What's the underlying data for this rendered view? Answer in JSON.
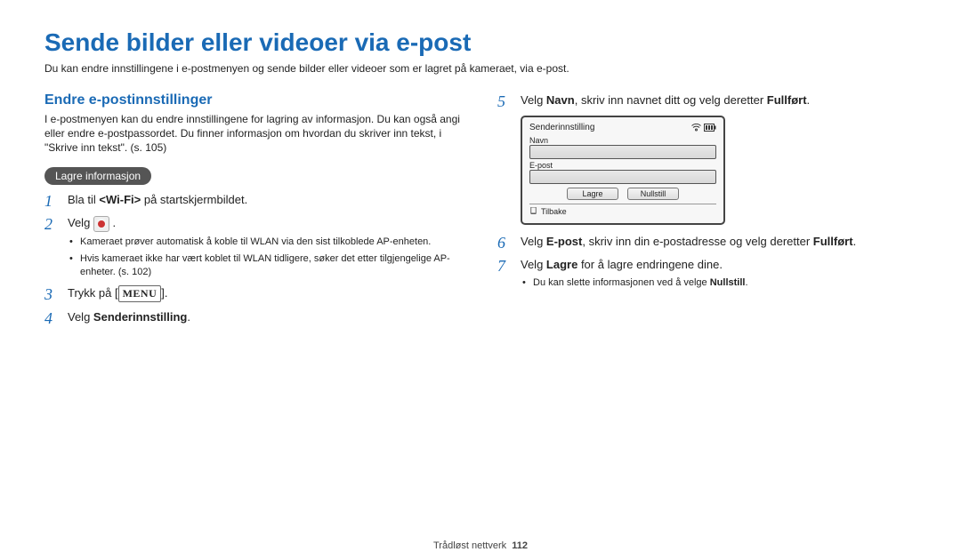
{
  "title": "Sende bilder eller videoer via e-post",
  "description": "Du kan endre innstillingene i e-postmenyen og sende bilder eller videoer som er lagret på kameraet, via e-post.",
  "section": {
    "heading": "Endre e-postinnstillinger",
    "body": "I e-postmenyen kan du endre innstillingene for lagring av informasjon. Du kan også angi eller endre e-postpassordet. Du finner informasjon om hvordan du skriver inn tekst, i \"Skrive inn tekst\". (s. 105)"
  },
  "pill_label": "Lagre informasjon",
  "left_steps": {
    "s1": {
      "pre": "Bla til ",
      "wifi": "<Wi-Fi>",
      "post": " på startskjermbildet."
    },
    "s2": {
      "pre": "Velg ",
      "post": " ."
    },
    "s2_subs": [
      "Kameraet prøver automatisk å koble til WLAN via den sist tilkoblede AP-enheten.",
      "Hvis kameraet ikke har vært koblet til WLAN tidligere, søker det etter tilgjengelige AP-enheter. (s. 102)"
    ],
    "s3": {
      "pre": "Trykk på [",
      "menu": "MENU",
      "post": "]."
    },
    "s4": {
      "pre": "Velg ",
      "bold": "Senderinnstilling",
      "post": "."
    }
  },
  "right_steps": {
    "s5": {
      "pre": "Velg ",
      "b1": "Navn",
      "mid": ", skriv inn navnet ditt og velg deretter ",
      "b2": "Fullført",
      "post": "."
    },
    "s6": {
      "pre": "Velg ",
      "b1": "E-post",
      "mid": ", skriv inn din e-postadresse og velg deretter ",
      "b2": "Fullført",
      "post": "."
    },
    "s7": {
      "pre": "Velg ",
      "b1": "Lagre",
      "post": " for å lagre endringene dine."
    },
    "s7_subs": [
      {
        "pre": "Du kan slette informasjonen ved å velge ",
        "b": "Nullstill",
        "post": "."
      }
    ]
  },
  "camera": {
    "header": "Senderinnstilling",
    "field1": "Navn",
    "field2": "E-post",
    "btn_save": "Lagre",
    "btn_reset": "Nullstill",
    "back": "Tilbake"
  },
  "footer": {
    "label": "Trådløst nettverk",
    "page": "112"
  }
}
